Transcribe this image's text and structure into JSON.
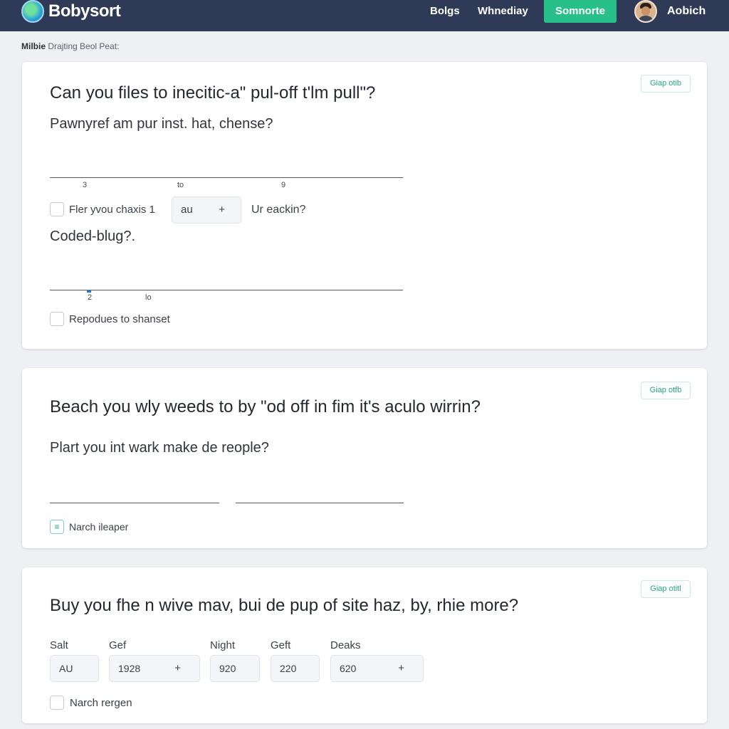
{
  "header": {
    "app_name": "Bobysort",
    "nav": [
      "Bolgs",
      "Whnediay"
    ],
    "cta_label": "Somnorte",
    "user_name": "Aobich"
  },
  "breadcrumb": {
    "strong": "Milbie",
    "rest": "Drajting Beol Peat:"
  },
  "cards": [
    {
      "tag": "Giap otib",
      "title": "Can you files to inecitic-a\" pul-off t'lm pull\"?",
      "subtitle": "Pawnyref am pur inst. hat, chense?",
      "scale1_ticks": [
        "3",
        "to",
        "9"
      ],
      "check1_label": "Fler yvou chaxis 1",
      "stepper_value": "au",
      "stepper_plus": "+",
      "after_stepper_text": "Ur eackin?",
      "subtitle2": "Coded-blug?.",
      "scale2_ticks": [
        "2",
        "lo"
      ],
      "check2_label": "Repodues to shanset"
    },
    {
      "tag": "Giap otfb",
      "title": "Beach you wly weeds to by \"od off in fim it's aculo wirrin?",
      "subtitle": "Plart you int wark make de reople?",
      "check_mark": "≡",
      "check_label": "Narch ileaper"
    },
    {
      "tag": "Giap otitl",
      "title": "Buy you fhe n wive mav, bui de pup of site haz, by, rhie more?",
      "fields": [
        {
          "label": "Salt",
          "value": "AU",
          "plus": ""
        },
        {
          "label": "Gef",
          "value": "1928",
          "plus": "+"
        },
        {
          "label": "Night",
          "value": "920",
          "plus": ""
        },
        {
          "label": "Geft",
          "value": "220",
          "plus": ""
        },
        {
          "label": "Deaks",
          "value": "620",
          "plus": "+"
        }
      ],
      "check_label": "Narch rergen"
    }
  ]
}
